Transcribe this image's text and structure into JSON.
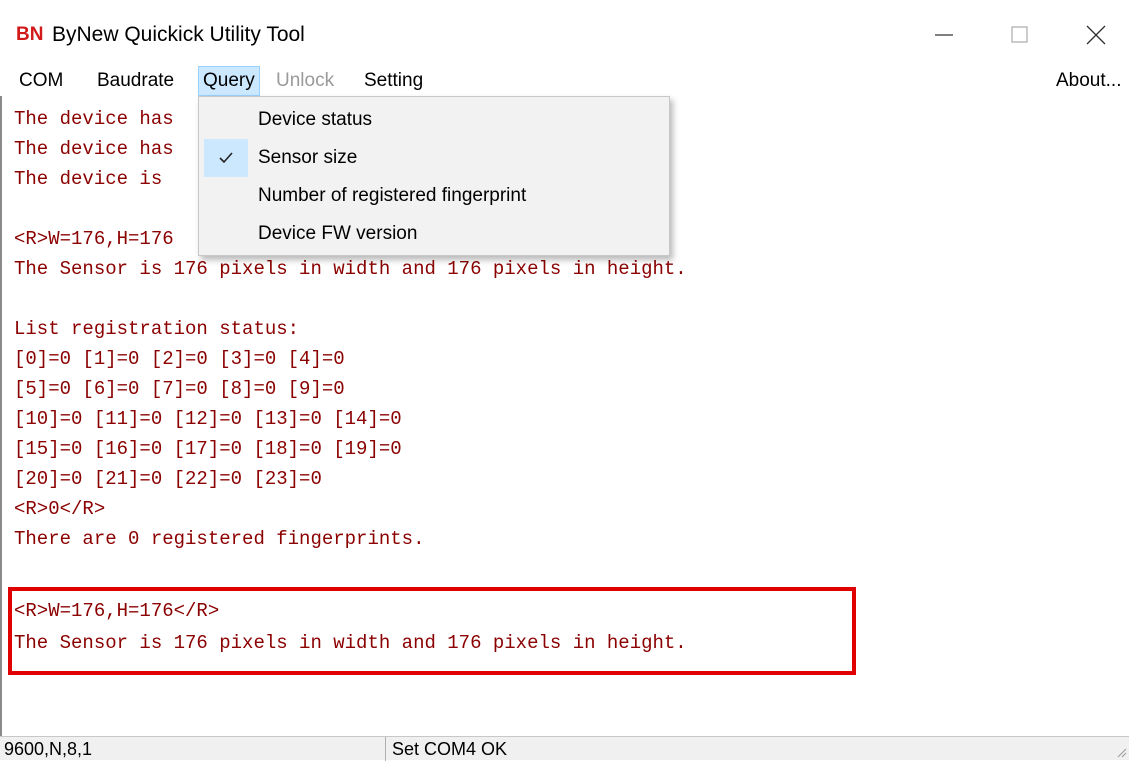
{
  "window": {
    "app_badge": "BN",
    "title": "ByNew Quickick Utility Tool",
    "minimize_icon": "minimize-icon",
    "maximize_icon": "maximize-icon",
    "close_icon": "close-icon"
  },
  "menubar": {
    "items": [
      "COM",
      "Baudrate",
      "Query",
      "Unlock",
      "Setting"
    ],
    "active": "Query",
    "disabled": "Unlock",
    "about": "About..."
  },
  "query_menu": {
    "items": [
      {
        "label": "Device status",
        "checked": false
      },
      {
        "label": "Sensor size",
        "checked": true
      },
      {
        "label": "Number of registered fingerprint",
        "checked": false
      },
      {
        "label": "Device FW version",
        "checked": false
      }
    ]
  },
  "console": {
    "lines": [
      "The device has",
      "The device has",
      "The device is",
      "",
      "<R>W=176,H=176",
      "The Sensor is 176 pixels in width and 176 pixels in height.",
      "",
      "List registration status:",
      "[0]=0 [1]=0 [2]=0 [3]=0 [4]=0",
      "[5]=0 [6]=0 [7]=0 [8]=0 [9]=0",
      "[10]=0 [11]=0 [12]=0 [13]=0 [14]=0",
      "[15]=0 [16]=0 [17]=0 [18]=0 [19]=0",
      "[20]=0 [21]=0 [22]=0 [23]=0",
      "<R>0</R>",
      "There are 0 registered fingerprints.",
      "",
      "<R>W=176,H=176</R>",
      "The Sensor is 176 pixels in width and 176 pixels in height."
    ],
    "text_color": "#8b0000",
    "highlight_color": "#e00000"
  },
  "statusbar": {
    "left": "9600,N,8,1",
    "right": "Set COM4 OK"
  },
  "colors": {
    "menu_highlight": "#cce8ff",
    "brand": "#d21a1a"
  }
}
